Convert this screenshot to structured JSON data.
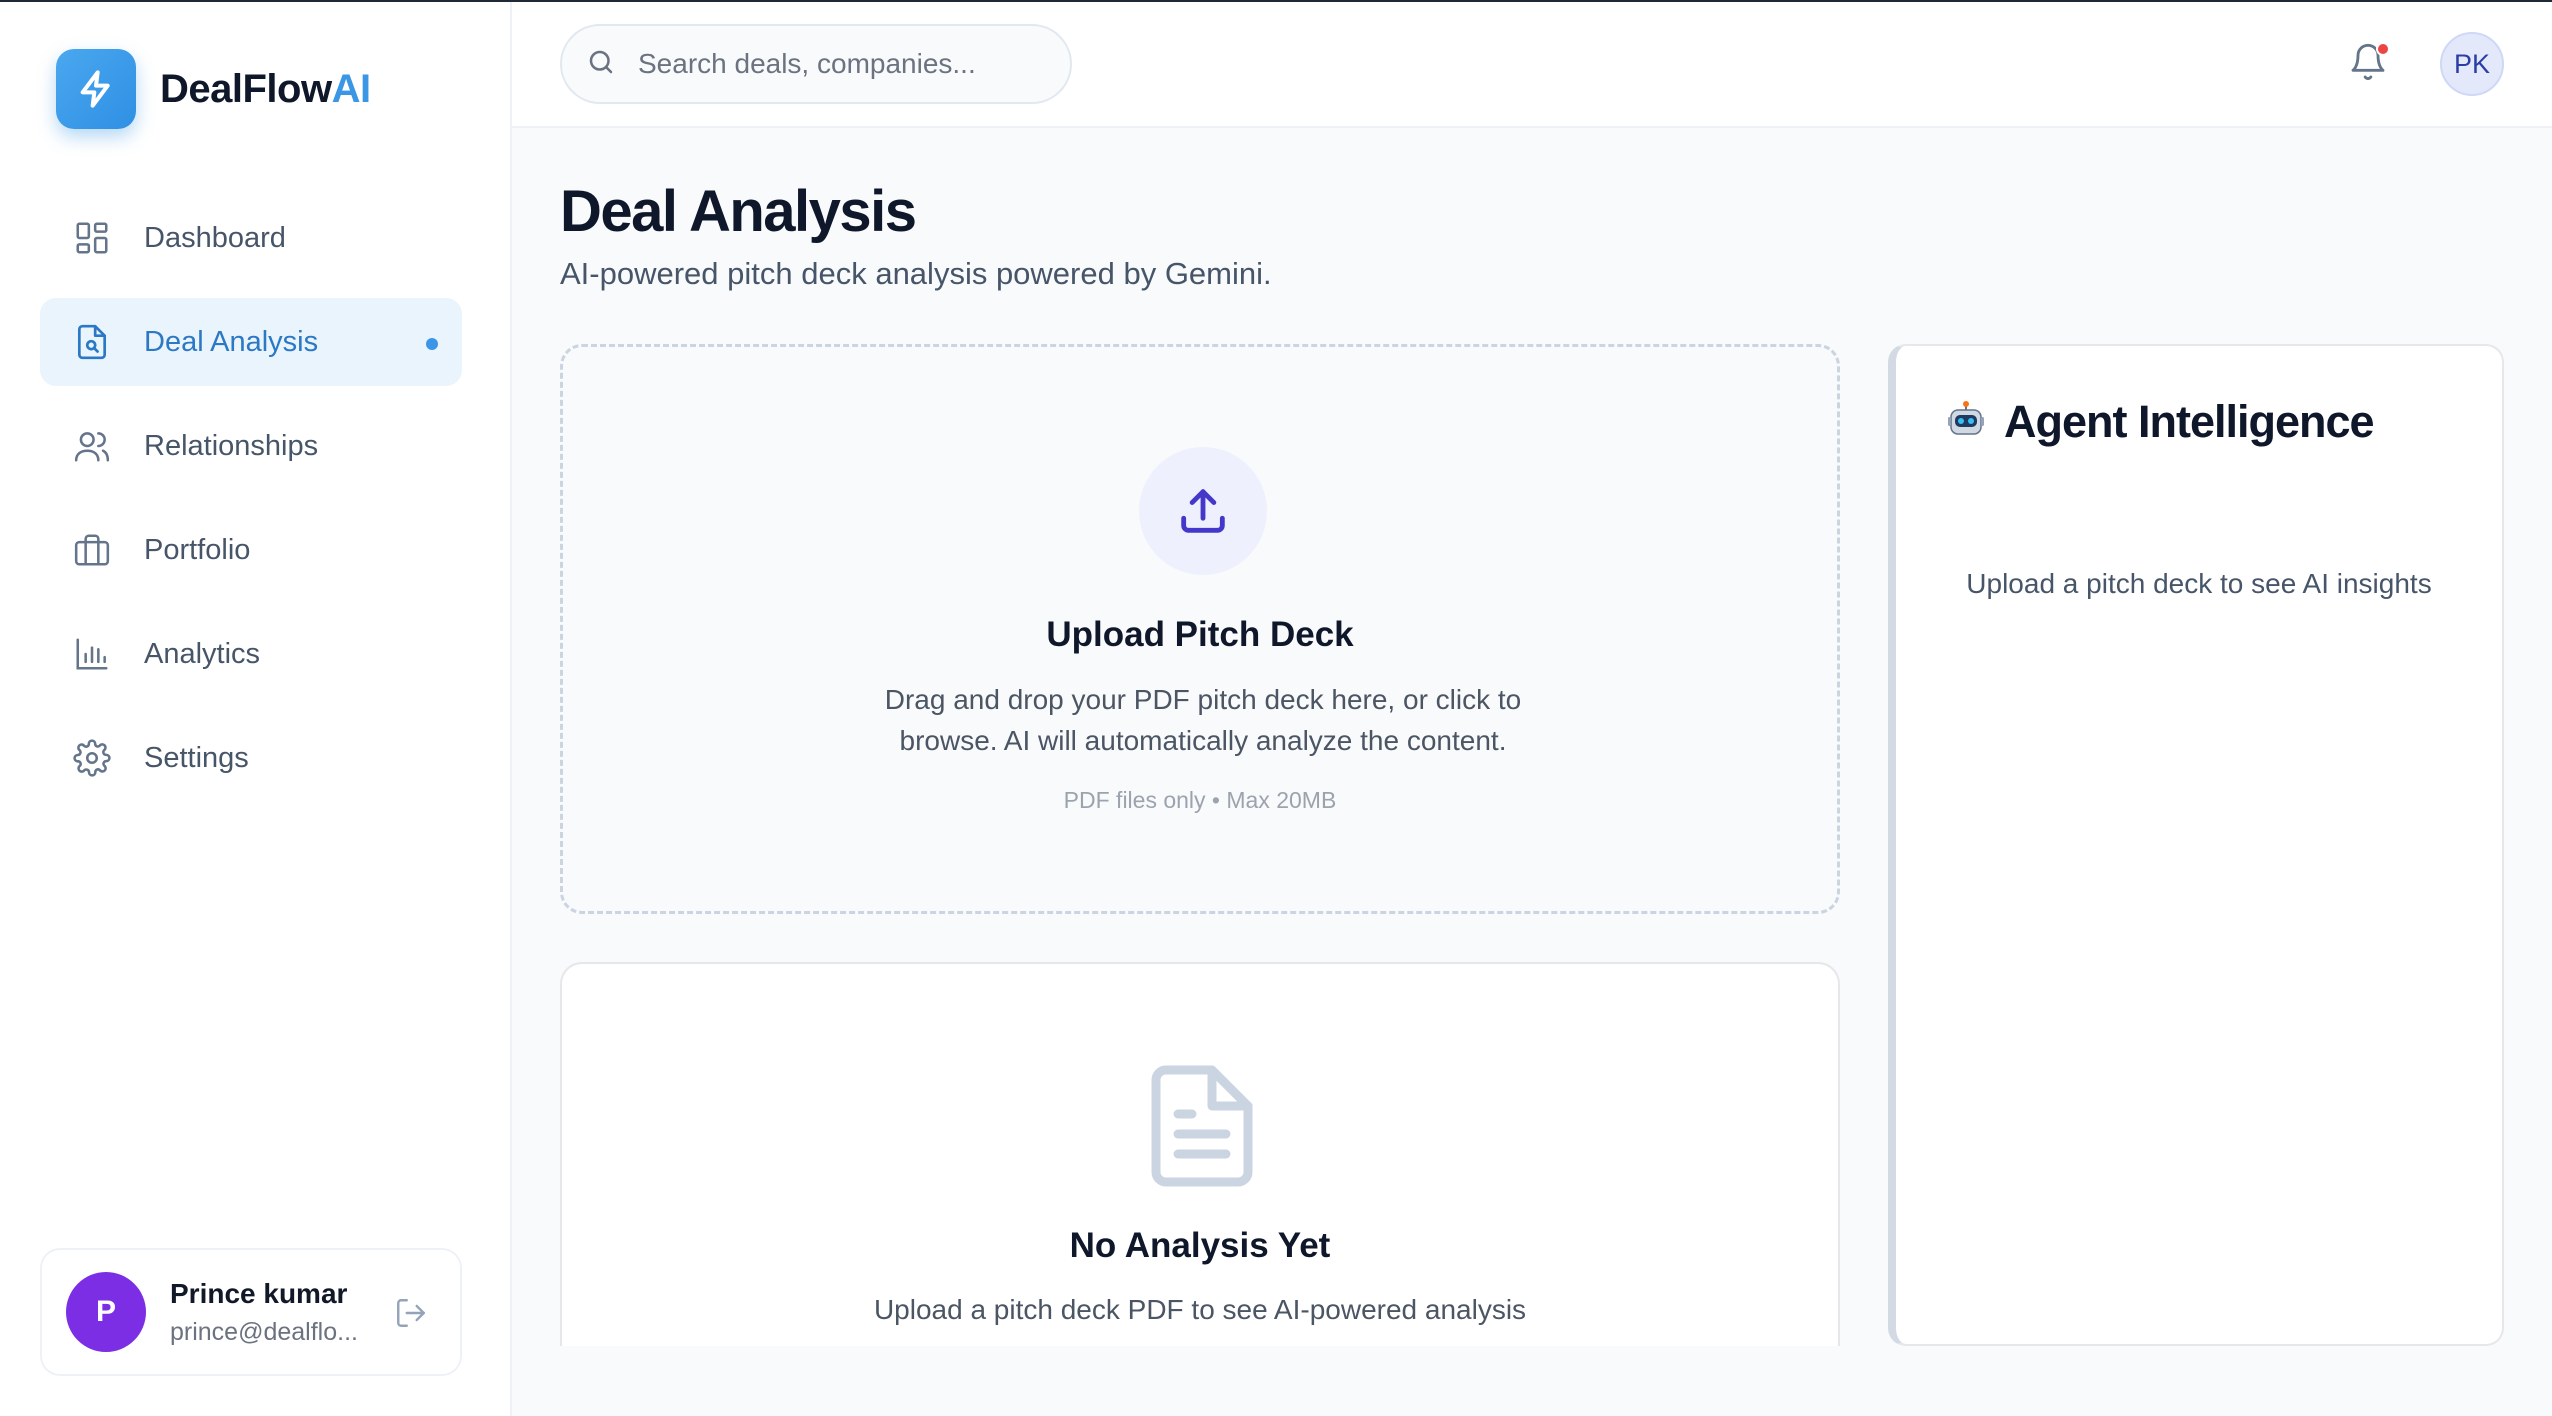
{
  "app": {
    "brand_main": "DealFlow",
    "brand_accent": "AI",
    "accent_color": "#3b96e6"
  },
  "sidebar": {
    "items": [
      {
        "label": "Dashboard",
        "icon": "grid-icon",
        "active": false
      },
      {
        "label": "Deal Analysis",
        "icon": "document-search-icon",
        "active": true
      },
      {
        "label": "Relationships",
        "icon": "users-icon",
        "active": false
      },
      {
        "label": "Portfolio",
        "icon": "briefcase-icon",
        "active": false
      },
      {
        "label": "Analytics",
        "icon": "bar-chart-icon",
        "active": false
      },
      {
        "label": "Settings",
        "icon": "gear-icon",
        "active": false
      }
    ],
    "user": {
      "initial": "P",
      "name": "Prince kumar",
      "email": "prince@dealflo..."
    }
  },
  "header": {
    "search_placeholder": "Search deals, companies...",
    "avatar_initials": "PK",
    "has_notification": true
  },
  "main": {
    "title": "Deal Analysis",
    "subtitle": "AI-powered pitch deck analysis powered by Gemini.",
    "upload": {
      "title": "Upload Pitch Deck",
      "description": "Drag and drop your PDF pitch deck here, or click to browse. AI will automatically analyze the content.",
      "hint": "PDF files only • Max 20MB"
    },
    "empty": {
      "title": "No Analysis Yet",
      "description": "Upload a pitch deck PDF to see AI-powered analysis"
    },
    "agent": {
      "emoji": "🤖",
      "title": "Agent Intelligence",
      "empty_text": "Upload a pitch deck to see AI insights"
    }
  }
}
